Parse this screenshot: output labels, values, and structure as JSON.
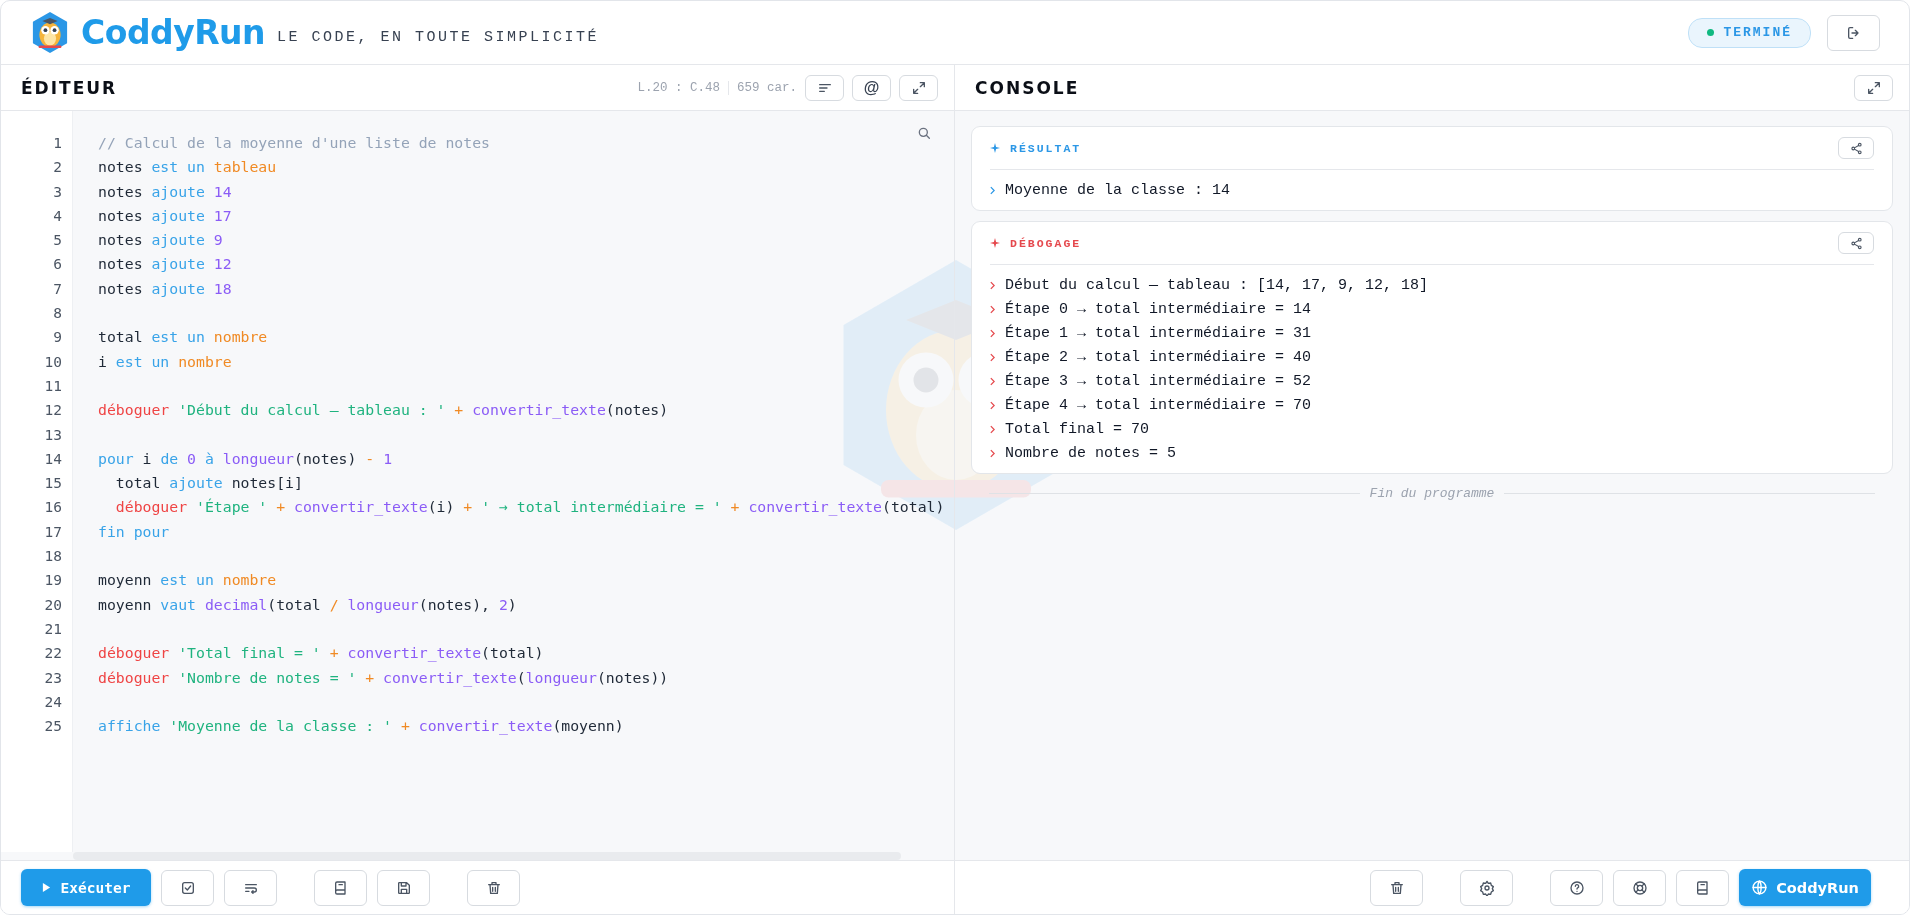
{
  "brand": {
    "name": "CoddyRun",
    "tagline": "LE CODE, EN TOUTE SIMPLICITÉ"
  },
  "status": {
    "label": "TERMINÉ",
    "color": "#10b981"
  },
  "editor": {
    "title": "ÉDITEUR",
    "cursor": "L.20 : C.48",
    "chars": "659 car.",
    "at_label": "@",
    "run_label": "Exécuter",
    "lines": [
      {
        "n": "1",
        "tokens": [
          {
            "kind": "comment",
            "text": "// Calcul de la moyenne d'une liste de notes"
          }
        ]
      },
      {
        "n": "2",
        "tokens": [
          {
            "kind": "plain",
            "text": "notes "
          },
          {
            "kind": "keyword",
            "text": "est un "
          },
          {
            "kind": "type",
            "text": "tableau"
          }
        ]
      },
      {
        "n": "3",
        "tokens": [
          {
            "kind": "plain",
            "text": "notes "
          },
          {
            "kind": "keyword",
            "text": "ajoute "
          },
          {
            "kind": "number",
            "text": "14"
          }
        ]
      },
      {
        "n": "4",
        "tokens": [
          {
            "kind": "plain",
            "text": "notes "
          },
          {
            "kind": "keyword",
            "text": "ajoute "
          },
          {
            "kind": "number",
            "text": "17"
          }
        ]
      },
      {
        "n": "5",
        "tokens": [
          {
            "kind": "plain",
            "text": "notes "
          },
          {
            "kind": "keyword",
            "text": "ajoute "
          },
          {
            "kind": "number",
            "text": "9"
          }
        ]
      },
      {
        "n": "6",
        "tokens": [
          {
            "kind": "plain",
            "text": "notes "
          },
          {
            "kind": "keyword",
            "text": "ajoute "
          },
          {
            "kind": "number",
            "text": "12"
          }
        ]
      },
      {
        "n": "7",
        "tokens": [
          {
            "kind": "plain",
            "text": "notes "
          },
          {
            "kind": "keyword",
            "text": "ajoute "
          },
          {
            "kind": "number",
            "text": "18"
          }
        ]
      },
      {
        "n": "8"
      },
      {
        "n": "9",
        "tokens": [
          {
            "kind": "plain",
            "text": "total "
          },
          {
            "kind": "keyword",
            "text": "est un "
          },
          {
            "kind": "type",
            "text": "nombre"
          }
        ]
      },
      {
        "n": "10",
        "tokens": [
          {
            "kind": "plain",
            "text": "i "
          },
          {
            "kind": "keyword",
            "text": "est un "
          },
          {
            "kind": "type",
            "text": "nombre"
          }
        ]
      },
      {
        "n": "11"
      },
      {
        "n": "12",
        "tokens": [
          {
            "kind": "debug",
            "text": "déboguer "
          },
          {
            "kind": "string",
            "text": "'Début du calcul — tableau : '"
          },
          {
            "kind": "operator",
            "text": " + "
          },
          {
            "kind": "function",
            "text": "convertir_texte"
          },
          {
            "kind": "plain",
            "text": "(notes)"
          }
        ]
      },
      {
        "n": "13"
      },
      {
        "n": "14",
        "tokens": [
          {
            "kind": "keyword",
            "text": "pour"
          },
          {
            "kind": "plain",
            "text": " i "
          },
          {
            "kind": "keyword",
            "text": "de "
          },
          {
            "kind": "number",
            "text": "0 "
          },
          {
            "kind": "keyword",
            "text": "à "
          },
          {
            "kind": "function",
            "text": "longueur"
          },
          {
            "kind": "plain",
            "text": "(notes) "
          },
          {
            "kind": "operator",
            "text": "- "
          },
          {
            "kind": "number",
            "text": "1"
          }
        ]
      },
      {
        "n": "15",
        "tokens": [
          {
            "kind": "plain",
            "text": "  total "
          },
          {
            "kind": "keyword",
            "text": "ajoute"
          },
          {
            "kind": "plain",
            "text": " notes[i]"
          }
        ]
      },
      {
        "n": "16",
        "tokens": [
          {
            "kind": "debug",
            "text": "  déboguer "
          },
          {
            "kind": "string",
            "text": "'Étape '"
          },
          {
            "kind": "operator",
            "text": " + "
          },
          {
            "kind": "function",
            "text": "convertir_texte"
          },
          {
            "kind": "plain",
            "text": "(i)"
          },
          {
            "kind": "operator",
            "text": " + "
          },
          {
            "kind": "string",
            "text": "' → total intermédiaire = '"
          },
          {
            "kind": "operator",
            "text": " + "
          },
          {
            "kind": "function",
            "text": "convertir_texte"
          },
          {
            "kind": "plain",
            "text": "(total)"
          }
        ]
      },
      {
        "n": "17",
        "tokens": [
          {
            "kind": "keyword",
            "text": "fin pour"
          }
        ]
      },
      {
        "n": "18"
      },
      {
        "n": "19",
        "tokens": [
          {
            "kind": "plain",
            "text": "moyenn "
          },
          {
            "kind": "keyword",
            "text": "est un "
          },
          {
            "kind": "type",
            "text": "nombre"
          }
        ]
      },
      {
        "n": "20",
        "tokens": [
          {
            "kind": "plain",
            "text": "moyenn "
          },
          {
            "kind": "keyword",
            "text": "vaut "
          },
          {
            "kind": "function",
            "text": "decimal"
          },
          {
            "kind": "plain",
            "text": "(total "
          },
          {
            "kind": "operator",
            "text": "/ "
          },
          {
            "kind": "function",
            "text": "longueur"
          },
          {
            "kind": "plain",
            "text": "(notes), "
          },
          {
            "kind": "number",
            "text": "2"
          },
          {
            "kind": "plain",
            "text": ")"
          }
        ]
      },
      {
        "n": "21"
      },
      {
        "n": "22",
        "tokens": [
          {
            "kind": "debug",
            "text": "déboguer "
          },
          {
            "kind": "string",
            "text": "'Total final = '"
          },
          {
            "kind": "operator",
            "text": " + "
          },
          {
            "kind": "function",
            "text": "convertir_texte"
          },
          {
            "kind": "plain",
            "text": "(total)"
          }
        ]
      },
      {
        "n": "23",
        "tokens": [
          {
            "kind": "debug",
            "text": "déboguer "
          },
          {
            "kind": "string",
            "text": "'Nombre de notes = '"
          },
          {
            "kind": "operator",
            "text": " + "
          },
          {
            "kind": "function",
            "text": "convertir_texte"
          },
          {
            "kind": "plain",
            "text": "("
          },
          {
            "kind": "function",
            "text": "longueur"
          },
          {
            "kind": "plain",
            "text": "(notes))"
          }
        ]
      },
      {
        "n": "24"
      },
      {
        "n": "25",
        "tokens": [
          {
            "kind": "keyword",
            "text": "affiche "
          },
          {
            "kind": "string",
            "text": "'Moyenne de la classe : '"
          },
          {
            "kind": "operator",
            "text": " + "
          },
          {
            "kind": "function",
            "text": "convertir_texte"
          },
          {
            "kind": "plain",
            "text": "(moyenn)"
          }
        ]
      }
    ]
  },
  "console": {
    "title": "CONSOLE",
    "sections": [
      {
        "kind": "result",
        "title": "RÉSULTAT",
        "lines": [
          "Moyenne de la classe : 14"
        ]
      },
      {
        "kind": "debug",
        "title": "DÉBOGAGE",
        "lines": [
          "Début du calcul — tableau : [14, 17, 9, 12, 18]",
          "Étape 0 → total intermédiaire = 14",
          "Étape 1 → total intermédiaire = 31",
          "Étape 2 → total intermédiaire = 40",
          "Étape 3 → total intermédiaire = 52",
          "Étape 4 → total intermédiaire = 70",
          "Total final = 70",
          "Nombre de notes = 5"
        ]
      }
    ],
    "end_text": "Fin du programme"
  },
  "footer": {
    "brand_button": "CoddyRun"
  }
}
